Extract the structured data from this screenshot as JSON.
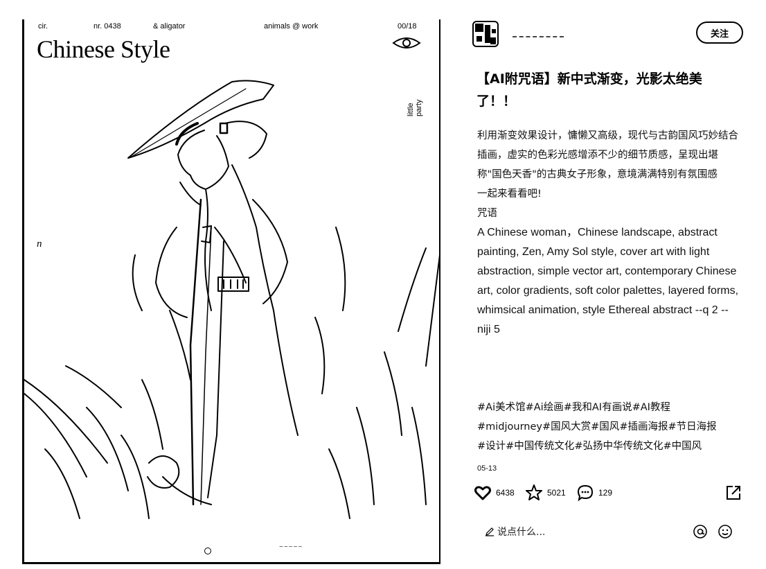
{
  "poster": {
    "meta_cir": "cir.",
    "meta_nr": "nr. 0438",
    "meta_alligator": "& aligator",
    "meta_animals": "animals @ work",
    "meta_page": "00/18",
    "title": "Chinese Style",
    "side_label": "little party",
    "letter": "n"
  },
  "note": {
    "follow_label": "关注",
    "title": "【AI附咒语】新中式渐变，光影太绝美了！！",
    "desc_lines": [
      "利用渐变效果设计，慵懒又高级，现代与古韵国风巧妙结合插画，虚实的色彩光感增添不少的细节质感，呈现出堪称\"国色天香\"的古典女子形象，意境满满特别有氛围感",
      "一起来看看吧!",
      "咒语"
    ],
    "prompt": "A Chinese woman，Chinese landscape, abstract painting, Zen, Amy Sol style, cover art with light abstraction, simple vector art, contemporary Chinese art, color gradients, soft color palettes, layered forms, whimsical animation, style Ethereal abstract --q 2 --niji 5",
    "tags": [
      "#Ai美术馆",
      "#Ai绘画",
      "#我和AI有画说",
      "#AI教程",
      "#midjourney",
      "#国风大赏",
      "#国风",
      "#插画海报",
      "#节日海报",
      "#设计",
      "#中国传统文化",
      "#弘扬中华传统文化",
      "#中国风"
    ],
    "date": "05-13",
    "likes": "6438",
    "collects": "5021",
    "comments": "129",
    "comment_placeholder": "说点什么..."
  },
  "icons": {
    "like": "heart-icon",
    "collect": "star-icon",
    "comment": "chat-bubble-icon",
    "share": "share-icon",
    "mention": "at-icon",
    "emoji": "smiley-icon",
    "edit": "pencil-icon",
    "eye": "eye-icon"
  }
}
